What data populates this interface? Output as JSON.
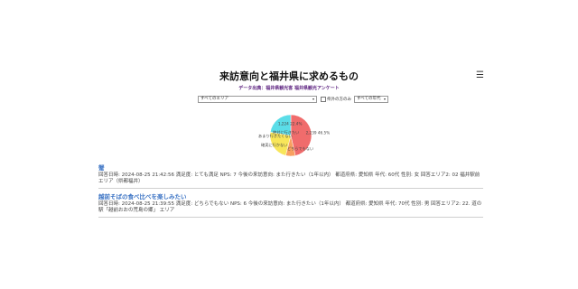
{
  "header": {
    "title": "来訪意向と福井県に求めるもの",
    "subtitle": "データ出典：福井県観光客 福井県観光アンケート",
    "menu_icon": "hamburger-menu-icon"
  },
  "filters": {
    "area_select": "すべてのエリア",
    "checkbox_label": "県外の方のみ",
    "age_select": "すべての年代"
  },
  "chart_data": {
    "type": "pie",
    "title": "",
    "slices": [
      {
        "label": "また行きたい",
        "value": 46.5,
        "display": "2,239 46.5%",
        "color": "#f06c6c"
      },
      {
        "label": "どちらでもない",
        "value": 7.5,
        "display": "",
        "color": "#f8a060"
      },
      {
        "label": "あまり行きたくない",
        "value": 23.6,
        "display": "",
        "color": "#f8e65a"
      },
      {
        "label": "絶対にまた行きたい",
        "value": 22.4,
        "display": "1,224 22.4%",
        "color": "#5bdde8"
      }
    ],
    "extra_labels": [
      "あまり行きたくない",
      "確実に行かない",
      "絶対に行きたい",
      "どちらでもない"
    ],
    "legend": "none"
  },
  "entries": [
    {
      "title": "蟹",
      "detail": "回答日時: 2024-08-25 21:42:56 満足度: とても満足 NPS: 7 今後の来訪意向: また行きたい（1年以内） 都道府県: 愛知県 年代: 60代 性別: 女 回答エリア2: 02 福井駅前 エリア（県都福井）"
    },
    {
      "title": "越前そばの食べ比べを楽しみたい",
      "detail": "回答日時: 2024-08-25 21:39:55 満足度: どちらでもない NPS: 6 今後の来訪意向: また行きたい（1年以内） 都道府県: 愛知県 年代: 70代 性別: 男 回答エリア2: 22. 道の駅「越前おおの荒島の郷」 エリア"
    }
  ]
}
